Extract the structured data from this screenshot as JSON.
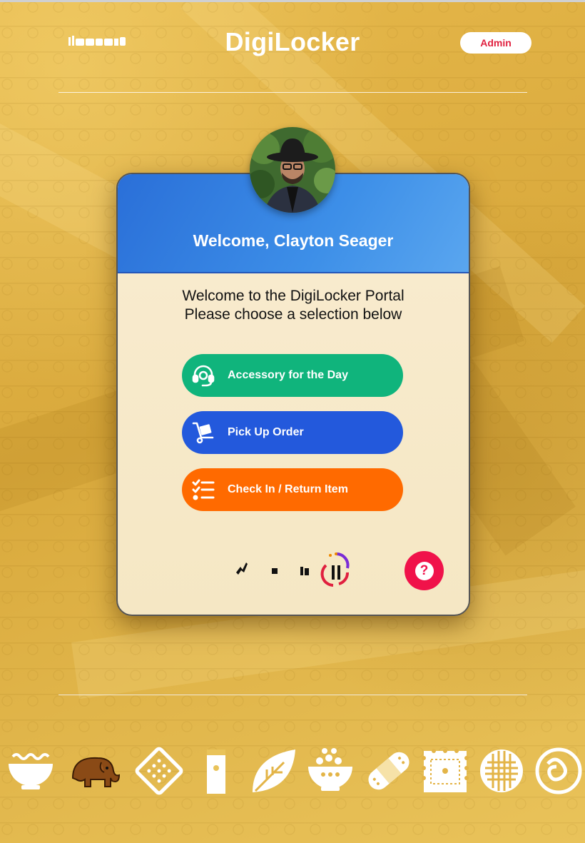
{
  "header": {
    "app_title": "DigiLocker",
    "admin_label": "Admin",
    "logo_icon": "brand-logo-icon"
  },
  "card": {
    "welcome": "Welcome, Clayton Seager",
    "intro_line1": "Welcome to the DigiLocker Portal",
    "intro_line2": "Please choose a selection below",
    "buttons": [
      {
        "label": "Accessory for the Day",
        "icon": "headset-icon",
        "color": "#10b47c"
      },
      {
        "label": "Pick Up Order",
        "icon": "hand-truck-icon",
        "color": "#2359dc"
      },
      {
        "label": "Check In / Return Item",
        "icon": "checklist-icon",
        "color": "#ff6a00"
      }
    ],
    "help_label": "?",
    "help_color": "#f0124a"
  },
  "footer": {
    "icons": [
      "noodle-bowl-icon",
      "elephant-icon",
      "cracker-icon",
      "tube-icon",
      "leaf-icon",
      "rice-bowl-icon",
      "bandage-icon",
      "biscuit-icon",
      "waffle-icon",
      "pasta-icon"
    ]
  },
  "colors": {
    "background": "#e3b447",
    "header_blue": "#2a6fd8"
  }
}
